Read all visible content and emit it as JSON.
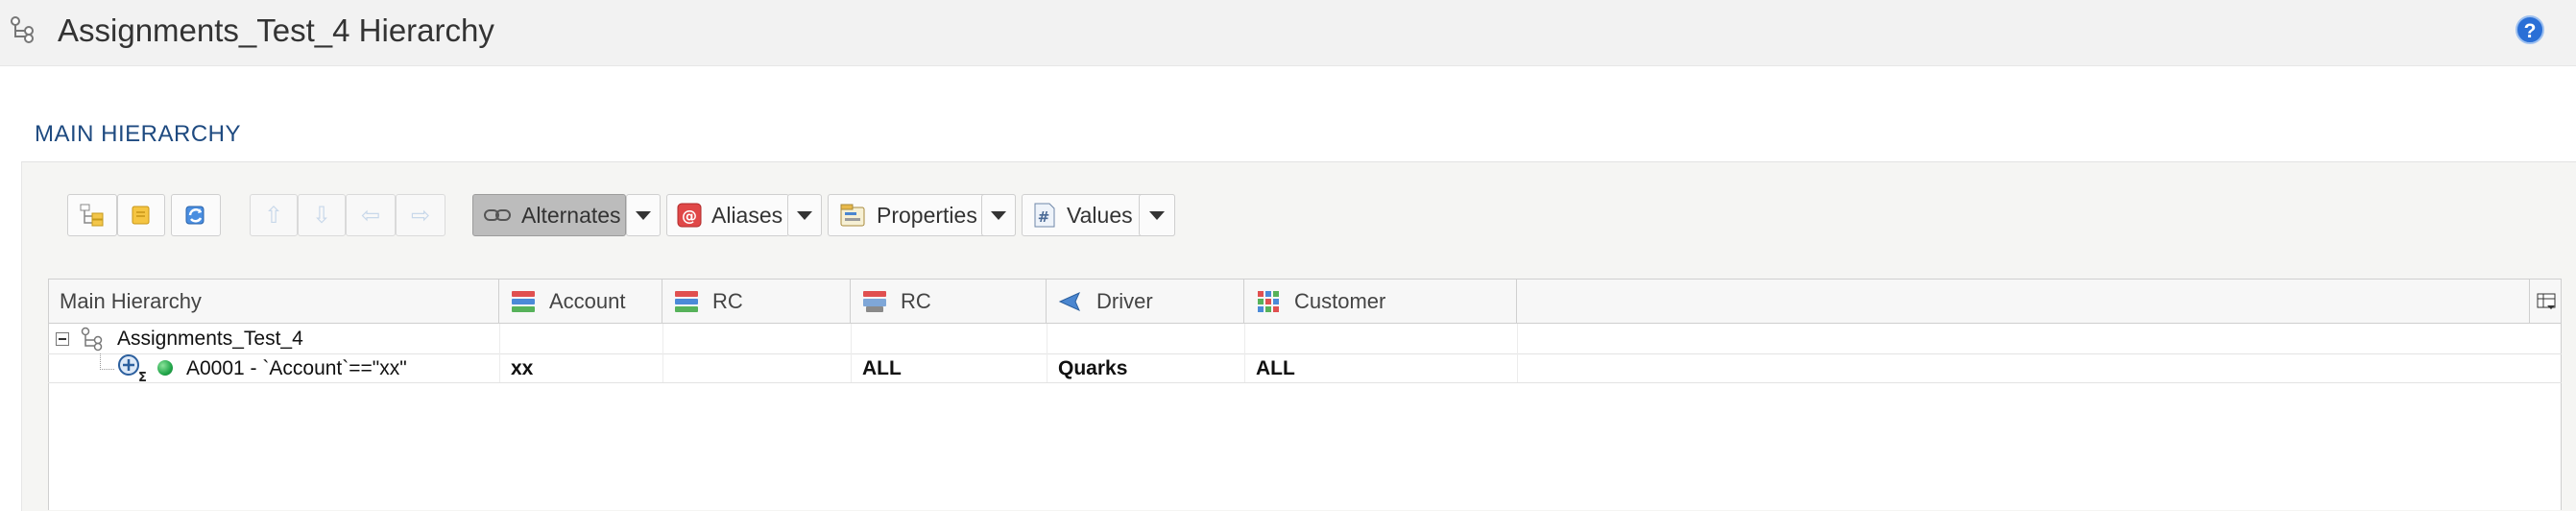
{
  "app": {
    "title": "Assignments_Test_4 Hierarchy",
    "help_label": "?"
  },
  "section": {
    "title": "MAIN HIERARCHY"
  },
  "toolbar": {
    "alternates_label": "Alternates",
    "aliases_label": "Aliases",
    "properties_label": "Properties",
    "values_label": "Values",
    "alternates_active": true
  },
  "grid": {
    "columns": [
      "Main Hierarchy",
      "Account",
      "RC",
      "RC",
      "Driver",
      "Customer"
    ],
    "rows": [
      {
        "label": "Assignments_Test_4",
        "values": [
          "",
          "",
          "",
          "",
          ""
        ]
      },
      {
        "label": "A0001 - `Account`==\"xx\"",
        "values": [
          "xx",
          "",
          "ALL",
          "Quarks",
          "ALL"
        ]
      }
    ]
  },
  "colors": {
    "section_title": "#1e4a80",
    "help": "#2a6fd6",
    "active_status": "#22a64a"
  }
}
